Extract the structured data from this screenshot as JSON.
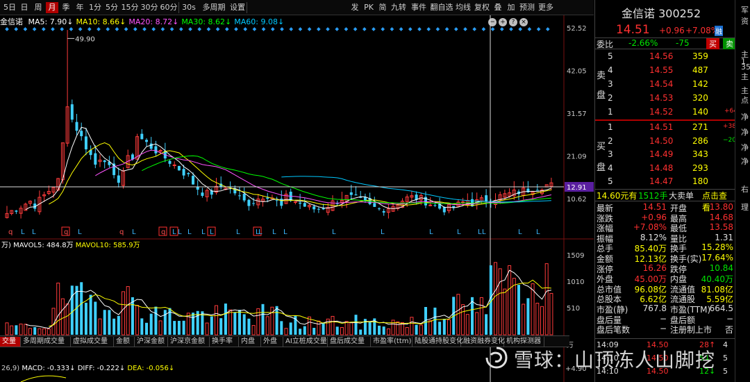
{
  "toolbar": {
    "left": [
      "5日",
      "日",
      "周",
      "月",
      "季",
      "年",
      "1分",
      "5分",
      "15分",
      "30分",
      "60分",
      "30s",
      "多周期",
      "设置"
    ],
    "active": "月",
    "right": [
      "发",
      "PK",
      "简",
      "九转",
      "事件",
      "翻自选",
      "均线",
      "复权",
      "叠",
      "加",
      "预测",
      "更多"
    ]
  },
  "ma_line": {
    "name": "金信诺",
    "items": [
      {
        "label": "MA5: 7.90",
        "arrow": "↓",
        "color": "#ffffff"
      },
      {
        "label": "MA10: 8.66",
        "arrow": "↓",
        "color": "#ffff00"
      },
      {
        "label": "MA20: 8.72",
        "arrow": "↓",
        "color": "#ff55ff"
      },
      {
        "label": "MA30: 8.62",
        "arrow": "↓",
        "color": "#00ff00"
      },
      {
        "label": "MA60: 9.08",
        "arrow": "↓",
        "color": "#00c8ff"
      }
    ]
  },
  "ma_buttons": [
    "−",
    "+",
    "?",
    "×"
  ],
  "chart_data": {
    "type": "candlestick",
    "price_axis_ticks": [
      "52.52",
      "42.05",
      "31.57",
      "21.09",
      "10.62"
    ],
    "price_ylim": [
      4.5,
      52.52
    ],
    "current_price_tag": "12.91",
    "high_annotation": "49.90",
    "volume_axis_ticks": [
      "1509",
      "1010",
      "510"
    ],
    "volume_unit": "万",
    "macd_axis_ticks": [
      "+4.90"
    ]
  },
  "volume_header": {
    "title": "万)",
    "mavol5": "MAVOL5: 484.8万",
    "mavol10": "MAVOL10: 585.9万"
  },
  "macd_header": {
    "params": "26,9)",
    "macd": "MACD: -0.333",
    "diff": "DIFF: -0.222",
    "dea": "DEA: -0.056"
  },
  "indicator_tabs": [
    "交量",
    "多周期成交量",
    "虚拟成交量",
    "金额",
    "沪深金额",
    "沪深京金额",
    "换手率",
    "内盘",
    "外盘",
    "AI立桩成交量",
    "盘后成交量",
    "市盈率(ttm)",
    "陆股通持股变化",
    "融资融券变化",
    "机构探测器"
  ],
  "active_indicator_tab": "交量",
  "quote": {
    "name": "金信诺",
    "code": "300252",
    "price": "14.51",
    "change": "+0.96",
    "pct": "+7.08%",
    "badge": "融",
    "weibi_label": "委比",
    "weibi": "-2.66%",
    "weicha": "-75",
    "buy_btn": "买",
    "sell_btn": "卖",
    "sell_label": [
      "卖",
      "盘"
    ],
    "buy_label": [
      "买",
      "盘"
    ],
    "asks": [
      {
        "level": "5",
        "price": "14.56",
        "vol": "359",
        "delta": ""
      },
      {
        "level": "4",
        "price": "14.55",
        "vol": "487",
        "delta": ""
      },
      {
        "level": "3",
        "price": "14.54",
        "vol": "142",
        "delta": ""
      },
      {
        "level": "2",
        "price": "14.53",
        "vol": "320",
        "delta": ""
      },
      {
        "level": "1",
        "price": "14.52",
        "vol": "140",
        "delta": "+64"
      }
    ],
    "bids": [
      {
        "level": "1",
        "price": "14.51",
        "vol": "271",
        "delta": "+38"
      },
      {
        "level": "2",
        "price": "14.50",
        "vol": "286",
        "delta": "−20"
      },
      {
        "level": "3",
        "price": "14.49",
        "vol": "343",
        "delta": ""
      },
      {
        "level": "4",
        "price": "14.48",
        "vol": "293",
        "delta": ""
      },
      {
        "level": "5",
        "price": "14.47",
        "vol": "180",
        "delta": ""
      }
    ],
    "big_order": {
      "price": "14.60元有",
      "vol": "1512手",
      "label": "大卖单",
      "link": "点击查看"
    },
    "stats": [
      [
        "最新",
        "14.51",
        "red",
        "开盘",
        "13.80",
        "red"
      ],
      [
        "涨跌",
        "+0.96",
        "red",
        "最高",
        "14.68",
        "red"
      ],
      [
        "涨幅",
        "+7.08%",
        "red",
        "最低",
        "13.58",
        "red"
      ],
      [
        "振幅",
        "8.12%",
        "white",
        "量比",
        "1.31",
        "white"
      ],
      [
        "总手",
        "85.40万",
        "yellow",
        "换手",
        "15.28%",
        "yellow"
      ],
      [
        "金额",
        "12.13亿",
        "yellow",
        "换手(实)",
        "17.64%",
        "yellow"
      ],
      [
        "涨停",
        "16.26",
        "red",
        "跌停",
        "10.84",
        "green"
      ],
      [
        "外盘",
        "45.00万",
        "red",
        "内盘",
        "40.40万",
        "green"
      ],
      [
        "总市值",
        "96.08亿",
        "yellow",
        "流通值",
        "81.08亿",
        "yellow"
      ],
      [
        "总股本",
        "6.62亿",
        "yellow",
        "流通股",
        "5.59亿",
        "yellow"
      ],
      [
        "市盈(静)",
        "767.8",
        "white",
        "市盈(TTM)",
        "664.5",
        "white"
      ],
      [
        "盘后量",
        "−",
        "white",
        "盘后额",
        "−",
        "white"
      ],
      [
        "盘后笔数",
        "−",
        "white",
        "注册制上市",
        "否",
        "white"
      ]
    ],
    "ticks": [
      {
        "time": "14:09",
        "price": "14.50",
        "vol": "28",
        "arrow": "↑",
        "n": "4"
      },
      {
        "time": "14:10",
        "price": "14.50",
        "vol": "5",
        "arrow": "↓",
        "n": "5"
      },
      {
        "time": "14:10",
        "price": "14.50",
        "vol": "12",
        "arrow": "↓",
        "n": "5"
      }
    ]
  },
  "edge_chars": [
    "军",
    "资",
    "主",
    "1",
    "35",
    "主",
    "主",
    "点",
    "净",
    "净",
    "净",
    "净",
    "右",
    "理"
  ],
  "watermark": "雪球：山顶冻人山脚挖"
}
